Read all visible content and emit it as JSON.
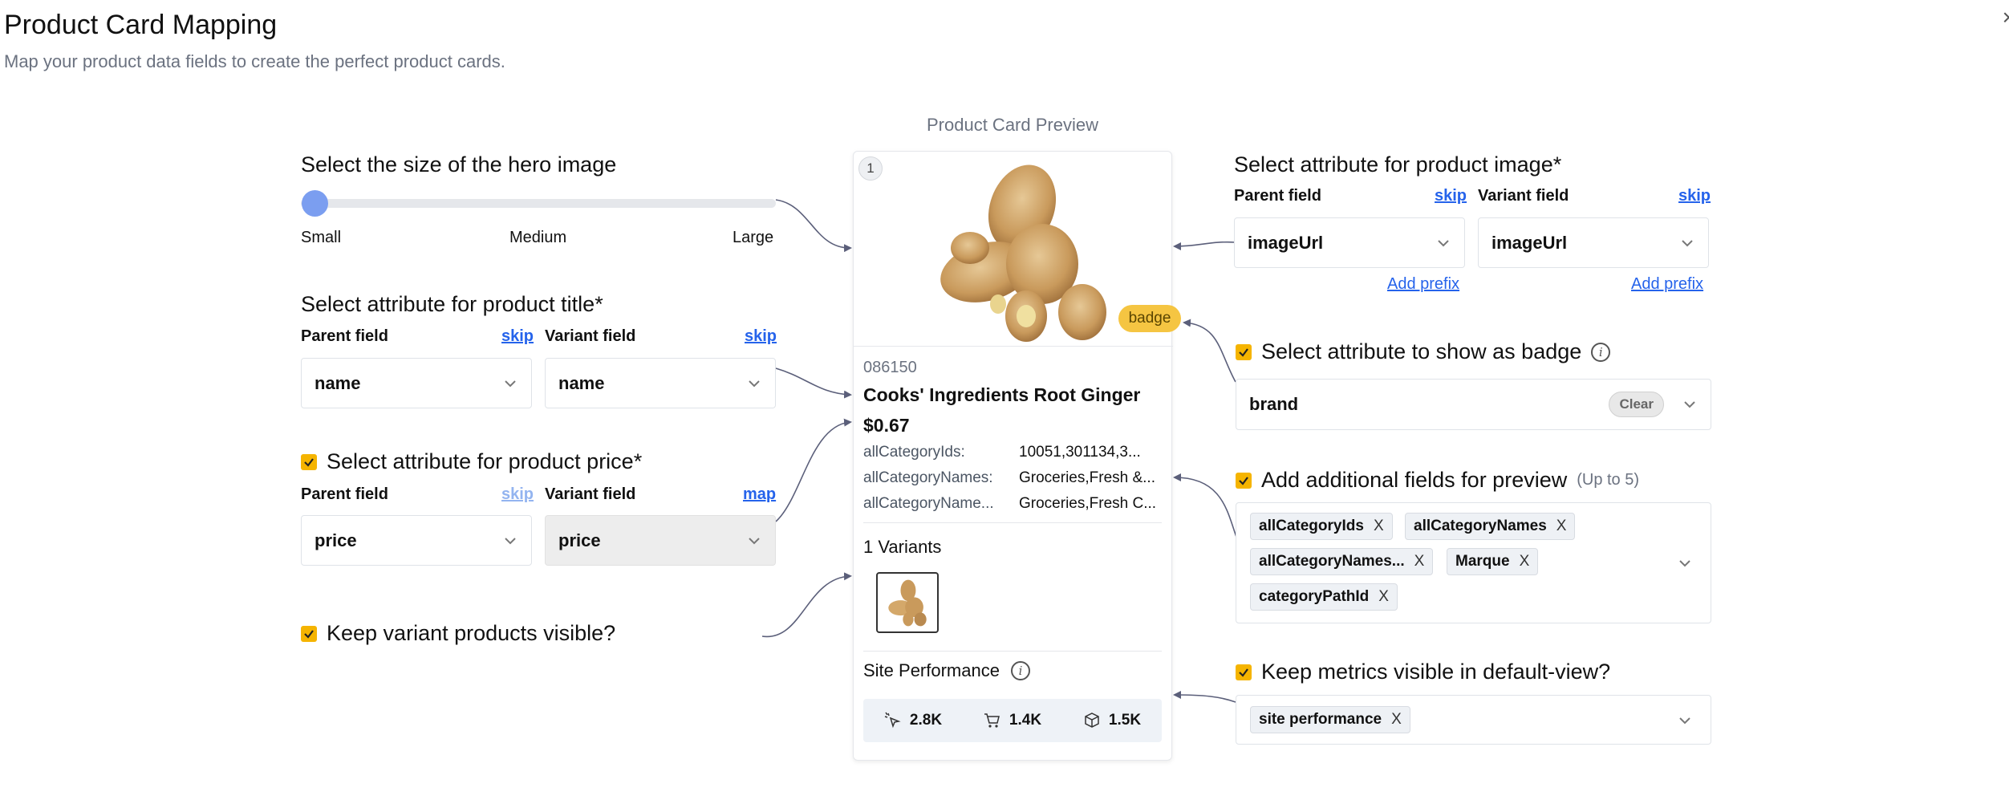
{
  "header": {
    "title": "Product Card Mapping",
    "subtitle": "Map your product data fields to create the perfect product cards.",
    "close_label": "×"
  },
  "hero_size": {
    "heading": "Select the size of the hero image",
    "options": [
      "Small",
      "Medium",
      "Large"
    ],
    "selected": "Small",
    "slider_value": 0
  },
  "product_title": {
    "heading": "Select attribute for product title*",
    "parent_label": "Parent field",
    "variant_label": "Variant field",
    "parent_skip": "skip",
    "variant_skip": "skip",
    "parent_value": "name",
    "variant_value": "name"
  },
  "product_price": {
    "checked": true,
    "heading": "Select attribute for product price*",
    "parent_label": "Parent field",
    "variant_label": "Variant field",
    "parent_skip": "skip",
    "variant_link": "map",
    "parent_value": "price",
    "variant_value": "price"
  },
  "keep_variants": {
    "checked": true,
    "heading": "Keep variant products visible?"
  },
  "product_image": {
    "heading": "Select attribute for product image*",
    "parent_label": "Parent field",
    "variant_label": "Variant field",
    "parent_skip": "skip",
    "variant_skip": "skip",
    "parent_value": "imageUrl",
    "variant_value": "imageUrl",
    "add_prefix": "Add prefix"
  },
  "badge": {
    "checked": true,
    "heading": "Select attribute to show as badge",
    "value": "brand",
    "clear_label": "Clear"
  },
  "additional_fields": {
    "checked": true,
    "heading": "Add additional fields for preview",
    "hint": "(Up to 5)",
    "tags": [
      "allCategoryIds",
      "allCategoryNames",
      "allCategoryNames...",
      "Marque",
      "categoryPathId"
    ],
    "remove_label": "X"
  },
  "metrics_visible": {
    "checked": true,
    "heading": "Keep metrics visible in default-view?",
    "tags": [
      "site performance"
    ],
    "remove_label": "X"
  },
  "preview": {
    "label": "Product Card Preview",
    "position": "1",
    "badge": "badge",
    "sku": "086150",
    "title": "Cooks' Ingredients Root Ginger",
    "price": "$0.67",
    "attributes": [
      {
        "name": "allCategoryIds:",
        "value": "10051,301134,3..."
      },
      {
        "name": "allCategoryNames:",
        "value": "Groceries,Fresh &..."
      },
      {
        "name": "allCategoryName...",
        "value": "Groceries,Fresh C..."
      }
    ],
    "variants_label": "1 Variants",
    "site_performance_label": "Site Performance",
    "metrics": [
      {
        "icon": "click-icon",
        "value": "2.8K"
      },
      {
        "icon": "cart-icon",
        "value": "1.4K"
      },
      {
        "icon": "box-icon",
        "value": "1.5K"
      }
    ]
  },
  "colors": {
    "accent": "#f5b400",
    "link": "#2563eb",
    "connector": "#5b5f7a",
    "slider": "#7b9ef0"
  }
}
